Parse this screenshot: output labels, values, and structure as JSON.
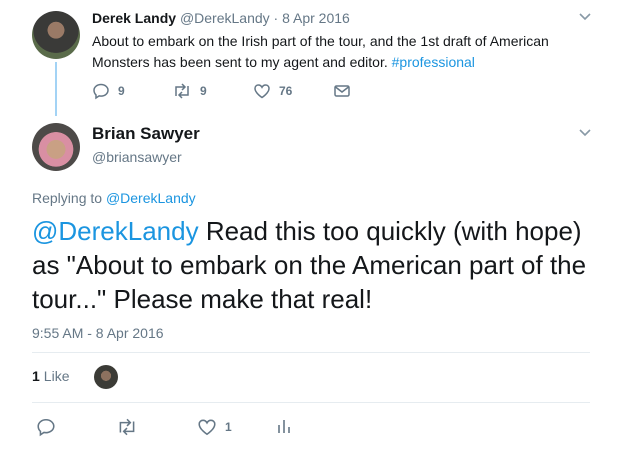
{
  "parent": {
    "name": "Derek Landy",
    "handle": "@DerekLandy",
    "date": "8 Apr 2016",
    "text_before": "About to embark on the Irish part of the tour, and the 1st draft of American Monsters has been sent to my agent and editor. ",
    "hashtag": "#professional",
    "replies": "9",
    "retweets": "9",
    "likes": "76"
  },
  "main": {
    "name": "Brian Sawyer",
    "handle": "@briansawyer",
    "replying_label": "Replying to ",
    "replying_to": "@DerekLandy",
    "mention": "@DerekLandy",
    "text": " Read this too quickly (with hope) as \"About to embark on the American part of the tour...\" Please make that real!",
    "timestamp": "9:55 AM - 8 Apr 2016",
    "like_count": "1",
    "like_label": "Like",
    "action_like_count": "1"
  },
  "colors": {
    "accent": "#1b95e0",
    "muted": "#657786",
    "thread": "#a3d3f5"
  }
}
